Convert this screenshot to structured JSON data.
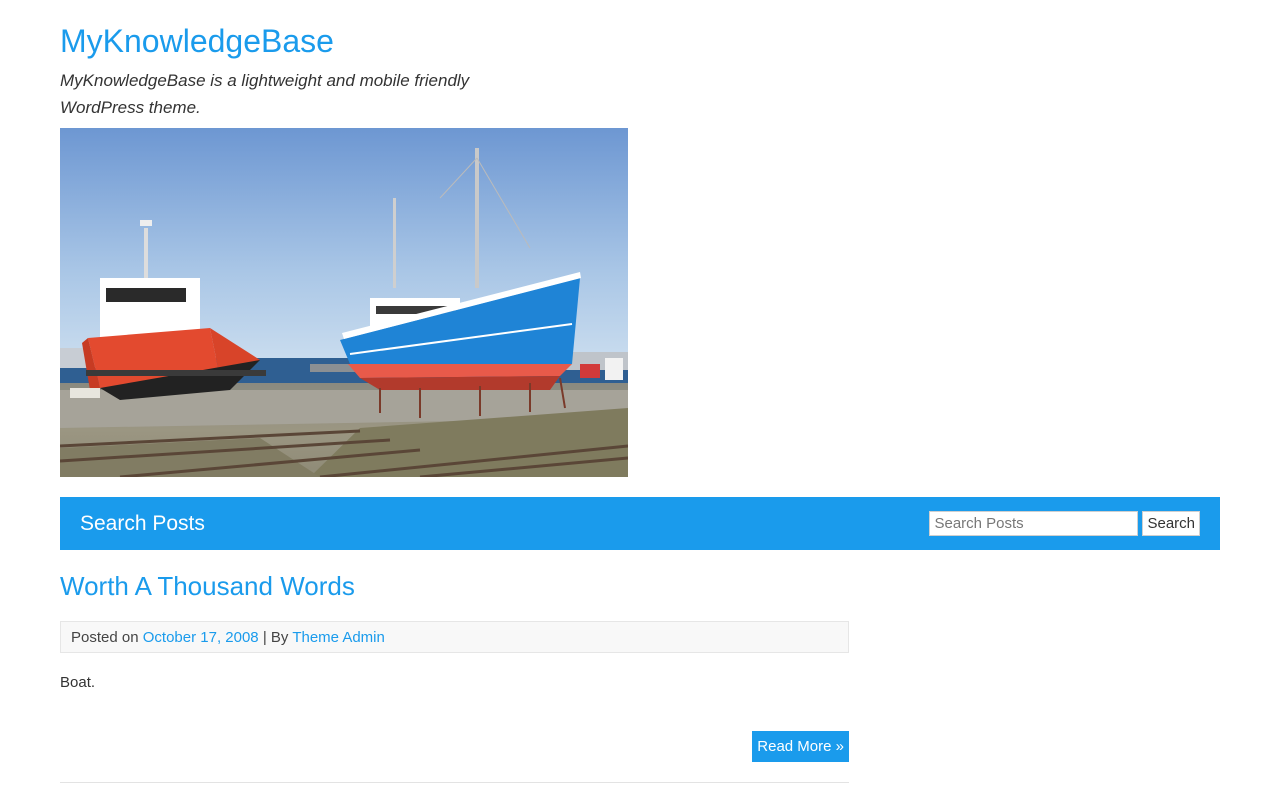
{
  "site": {
    "title": "MyKnowledgeBase",
    "description": "MyKnowledgeBase is a lightweight and mobile friendly WordPress theme."
  },
  "header_image": {
    "subject": "boats-in-dry-dock-photo"
  },
  "search": {
    "heading": "Search Posts",
    "placeholder": "Search Posts",
    "button_label": "Search"
  },
  "post": {
    "title": "Worth A Thousand Words",
    "meta_prefix": "Posted on",
    "date": "October 17, 2008",
    "meta_sep": "| By",
    "author": "Theme Admin",
    "excerpt": "Boat.",
    "read_more": "Read More »"
  },
  "colors": {
    "accent": "#1a9bec",
    "text": "#333333"
  }
}
